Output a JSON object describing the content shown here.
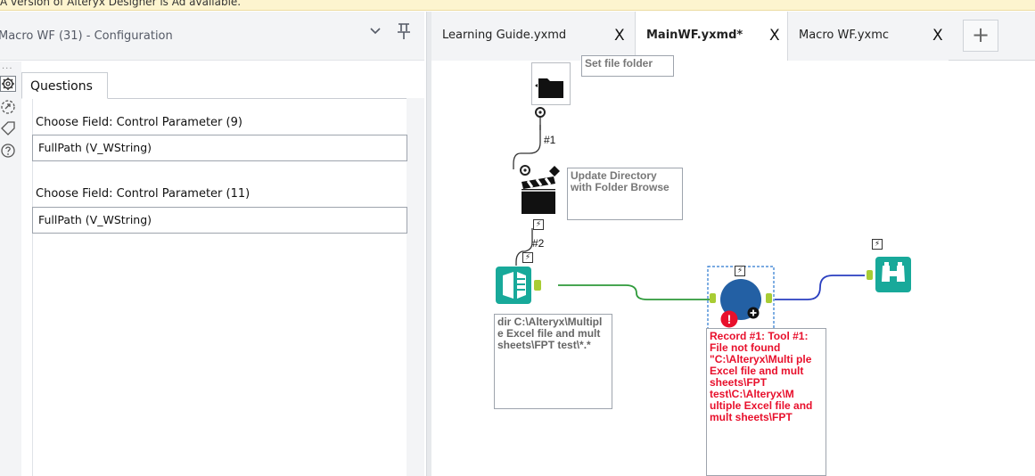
{
  "banner": {
    "text": "A version of Alteryx Designer is Ad available."
  },
  "config": {
    "title": "Macro WF (31) - Configuration",
    "tab": "Questions",
    "questions": [
      {
        "label": "Choose Field: Control Parameter (9)",
        "value": "FullPath (V_WString)"
      },
      {
        "label": "Choose Field: Control Parameter (11)",
        "value": "FullPath (V_WString)"
      }
    ],
    "rail_icons": [
      "gear-icon",
      "macro-icon",
      "tag-icon",
      "help-icon"
    ],
    "rail_dots": "..."
  },
  "tabs": [
    {
      "label": "Learning Guide.yxmd",
      "close": "X",
      "active": false
    },
    {
      "label": "MainWF.yxmd*",
      "close": "X",
      "active": true
    },
    {
      "label": "Macro WF.yxmc",
      "close": "X",
      "active": false
    }
  ],
  "add_tab": "+",
  "canvas": {
    "annotations": {
      "folder_browse": "Set file folder",
      "update_directory": "Update Directory with Folder Browse",
      "directory": "dir C:\\Alteryx\\Multipl e Excel file and mult sheets\\FPT test\\*.*",
      "error": "Record #1: Tool #1: File not found \"C:\\Alteryx\\Multi ple Excel file and mult sheets\\FPT test\\C:\\Alteryx\\M ultiple Excel file and mult sheets\\FPT"
    },
    "connection_labels": {
      "c1": "#1",
      "c2": "#2"
    },
    "bolt": "⚡",
    "error_badge": "!",
    "plus_badge": "+",
    "colors": {
      "green_conn": "#2e9a3a",
      "blue_conn": "#2a3fc0",
      "macro": "#2360a4",
      "browse": "#18a99a",
      "error": "#e8102c"
    }
  }
}
